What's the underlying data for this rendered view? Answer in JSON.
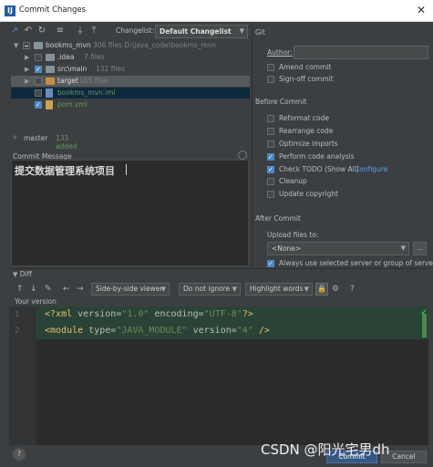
{
  "window": {
    "title": "Commit Changes",
    "close_glyph": "✕"
  },
  "toolbar": {
    "changelist_label": "Changelist:",
    "changelist_value": "Default Changelist"
  },
  "tree": {
    "rows": [
      {
        "name": "bookms_mvn",
        "meta": "306 files  D:\\java_code\\bookms_mvn"
      },
      {
        "name": ".idea",
        "meta": "7 files"
      },
      {
        "name": "src\\main",
        "meta": "132 files"
      },
      {
        "name": "target",
        "meta": "165 files"
      },
      {
        "name": "bookms_mvn.iml",
        "meta": ""
      },
      {
        "name": "pom.xml",
        "meta": ""
      }
    ]
  },
  "status": {
    "branch": "master",
    "added": "133 added"
  },
  "commit_message": {
    "label": "Commit Message",
    "text": "提交数据管理系统项目"
  },
  "git": {
    "header": "Git",
    "author_label": "Author:",
    "author_value": "",
    "amend": "Amend commit",
    "signoff": "Sign-off commit"
  },
  "before_commit": {
    "header": "Before Commit",
    "options": [
      {
        "label": "Reformat code",
        "checked": false
      },
      {
        "label": "Rearrange code",
        "checked": false
      },
      {
        "label": "Optimize imports",
        "checked": false
      },
      {
        "label": "Perform code analysis",
        "checked": true
      },
      {
        "label": "Check TODO (Show All)",
        "checked": true,
        "link": "Configure"
      },
      {
        "label": "Cleanup",
        "checked": false
      },
      {
        "label": "Update copyright",
        "checked": false
      }
    ]
  },
  "after_commit": {
    "header": "After Commit",
    "upload_label": "Upload files to:",
    "upload_value": "<None>",
    "dots": "...",
    "always_use": "Always use selected server or group of servers"
  },
  "diff": {
    "header": "Diff",
    "viewer": "Side-by-side viewer",
    "ignore": "Do not ignore",
    "highlight": "Highlight words",
    "your_version": "Your version",
    "lines": [
      {
        "num": "1",
        "tokens": [
          {
            "t": "<?",
            "c": "tk-pun"
          },
          {
            "t": "xml ",
            "c": "tk-tag"
          },
          {
            "t": "version",
            "c": "tk-attr"
          },
          {
            "t": "=",
            "c": "tk-attr"
          },
          {
            "t": "\"1.0\"",
            "c": "tk-val"
          },
          {
            "t": " encoding",
            "c": "tk-attr"
          },
          {
            "t": "=",
            "c": "tk-attr"
          },
          {
            "t": "\"UTF-8\"",
            "c": "tk-val"
          },
          {
            "t": "?>",
            "c": "tk-pun"
          }
        ]
      },
      {
        "num": "2",
        "tokens": [
          {
            "t": "<module ",
            "c": "tk-tag"
          },
          {
            "t": "type",
            "c": "tk-attr"
          },
          {
            "t": "=",
            "c": "tk-attr"
          },
          {
            "t": "\"JAVA_MODULE\"",
            "c": "tk-val"
          },
          {
            "t": " version",
            "c": "tk-attr"
          },
          {
            "t": "=",
            "c": "tk-attr"
          },
          {
            "t": "\"4\"",
            "c": "tk-val"
          },
          {
            "t": " />",
            "c": "tk-tag"
          }
        ]
      }
    ]
  },
  "footer": {
    "help": "?",
    "commit": "Commit",
    "cancel": "Cancel"
  },
  "watermark": "CSDN @阳光宅男dh",
  "colors": {
    "accent": "#4a88c7",
    "added_green": "#629755",
    "diff_bg": "#294436",
    "link": "#589df6"
  }
}
